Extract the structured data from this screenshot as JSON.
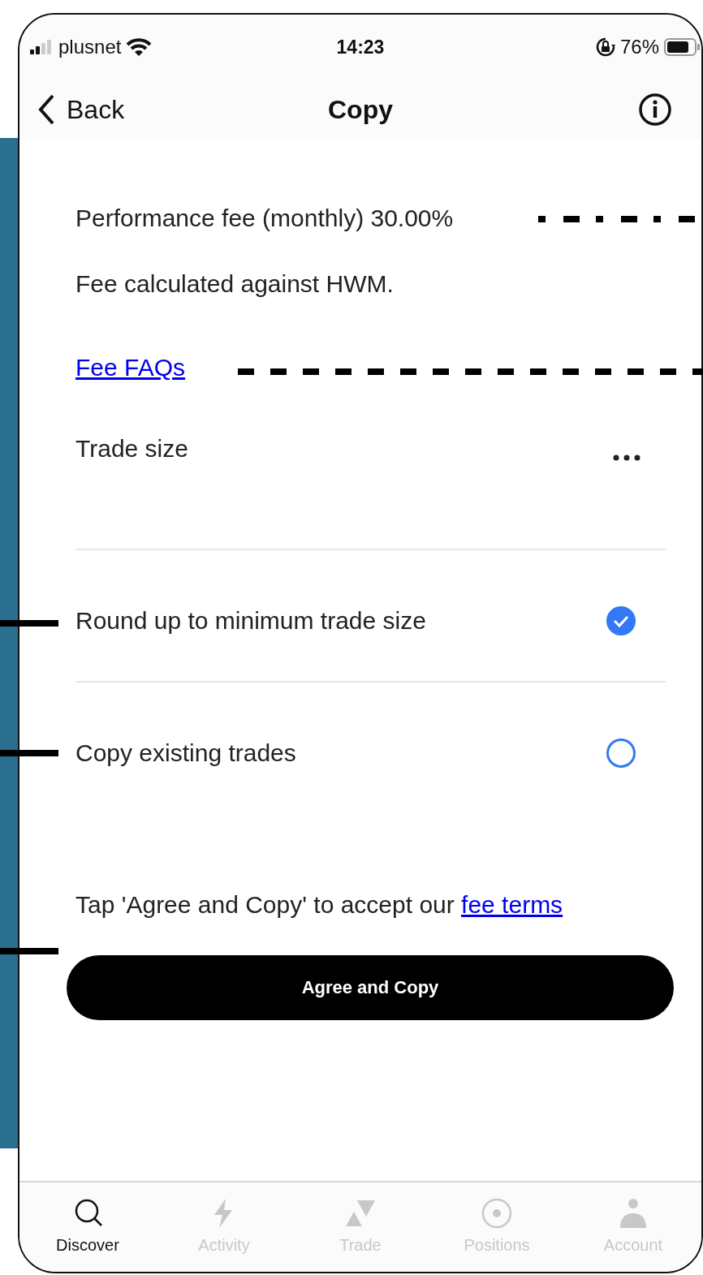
{
  "status_bar": {
    "carrier": "plusnet",
    "time": "14:23",
    "battery": "76%"
  },
  "nav": {
    "back": "Back",
    "title": "Copy"
  },
  "fees": {
    "performance": "Performance fee (monthly) 30.00%",
    "note": "Fee calculated against HWM.",
    "faq_link": "Fee FAQs"
  },
  "trade_size": {
    "label": "Trade size"
  },
  "options": [
    {
      "label": "Round up to minimum trade size",
      "checked": true
    },
    {
      "label": "Copy existing trades",
      "checked": false
    }
  ],
  "terms": {
    "text": "Tap 'Agree and Copy' to accept our ",
    "link": "fee terms"
  },
  "button": "Agree and Copy",
  "tabs": [
    {
      "label": "Discover",
      "selected": true
    },
    {
      "label": "Activity",
      "selected": false
    },
    {
      "label": "Trade",
      "selected": false
    },
    {
      "label": "Positions",
      "selected": false
    },
    {
      "label": "Account",
      "selected": false
    }
  ]
}
